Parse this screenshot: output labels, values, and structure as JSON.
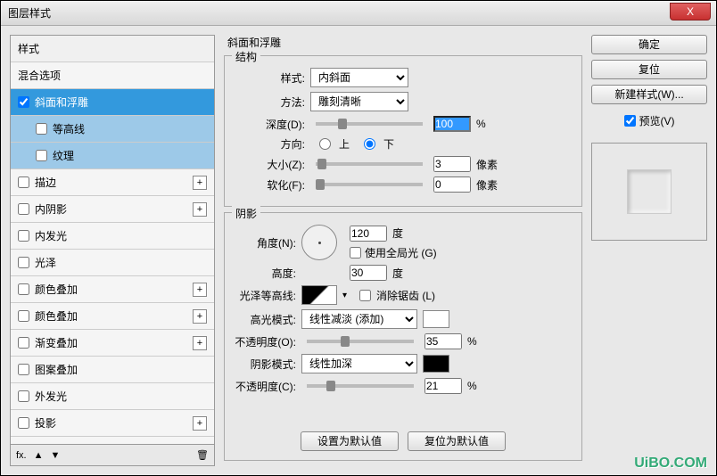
{
  "window": {
    "title": "图层样式",
    "close": "X"
  },
  "sidebar": {
    "header": "样式",
    "blend": "混合选项",
    "items": [
      {
        "label": "斜面和浮雕",
        "checked": true,
        "selected": true,
        "plus": false
      },
      {
        "label": "等高线",
        "sub": true,
        "subsel": true
      },
      {
        "label": "纹理",
        "sub": true,
        "subsel": true
      },
      {
        "label": "描边",
        "plus": true
      },
      {
        "label": "内阴影",
        "plus": true
      },
      {
        "label": "内发光"
      },
      {
        "label": "光泽"
      },
      {
        "label": "颜色叠加",
        "plus": true
      },
      {
        "label": "颜色叠加",
        "plus": true
      },
      {
        "label": "渐变叠加",
        "plus": true
      },
      {
        "label": "图案叠加"
      },
      {
        "label": "外发光"
      },
      {
        "label": "投影",
        "plus": true
      }
    ],
    "footer": {
      "fx": "fx.",
      "up": "▲",
      "down": "▼",
      "trash": "🗑"
    }
  },
  "main": {
    "section_title": "斜面和浮雕",
    "structure": {
      "title": "结构",
      "style_label": "样式:",
      "style_value": "内斜面",
      "method_label": "方法:",
      "method_value": "雕刻清晰",
      "depth_label": "深度(D):",
      "depth_value": "100",
      "depth_unit": "%",
      "direction_label": "方向:",
      "up": "上",
      "down": "下",
      "size_label": "大小(Z):",
      "size_value": "3",
      "size_unit": "像素",
      "soften_label": "软化(F):",
      "soften_value": "0",
      "soften_unit": "像素"
    },
    "shadow": {
      "title": "阴影",
      "angle_label": "角度(N):",
      "angle_value": "120",
      "angle_unit": "度",
      "global_label": "使用全局光 (G)",
      "altitude_label": "高度:",
      "altitude_value": "30",
      "altitude_unit": "度",
      "gloss_label": "光泽等高线:",
      "antialias_label": "消除锯齿 (L)",
      "highlight_mode_label": "高光模式:",
      "highlight_mode_value": "线性减淡 (添加)",
      "highlight_opacity_label": "不透明度(O):",
      "highlight_opacity_value": "35",
      "highlight_opacity_unit": "%",
      "shadow_mode_label": "阴影模式:",
      "shadow_mode_value": "线性加深",
      "shadow_opacity_label": "不透明度(C):",
      "shadow_opacity_value": "21",
      "shadow_opacity_unit": "%"
    },
    "defaults": {
      "set": "设置为默认值",
      "reset": "复位为默认值"
    }
  },
  "right": {
    "ok": "确定",
    "cancel": "复位",
    "new_style": "新建样式(W)...",
    "preview": "预览(V)"
  },
  "watermark": "UiBO.COM"
}
